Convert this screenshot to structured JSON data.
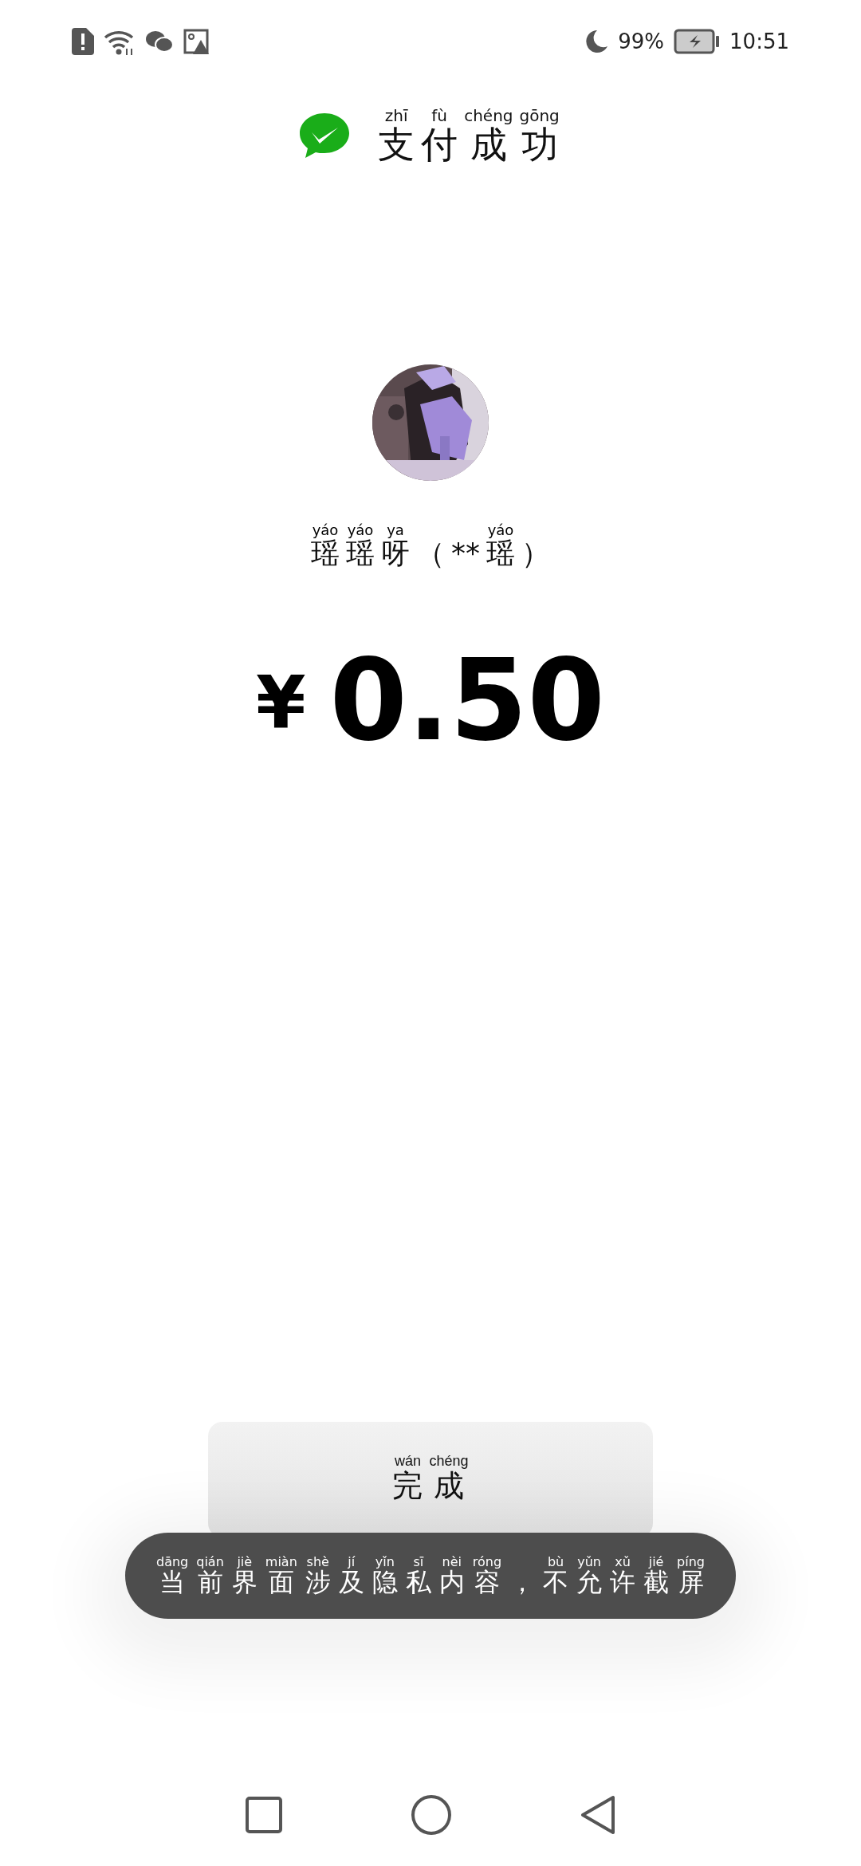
{
  "status_bar": {
    "battery_percent": "99%",
    "time": "10:51"
  },
  "header": {
    "title": [
      {
        "han": "支",
        "pinyin": "zhī"
      },
      {
        "han": "付",
        "pinyin": "fù"
      },
      {
        "han": "成",
        "pinyin": "chéng"
      },
      {
        "han": "功",
        "pinyin": "gōng"
      }
    ]
  },
  "payee": {
    "name": [
      {
        "han": "瑶",
        "pinyin": "yáo"
      },
      {
        "han": "瑶",
        "pinyin": "yáo"
      },
      {
        "han": "呀",
        "pinyin": "ya"
      },
      {
        "han": "（"
      },
      {
        "han": "**"
      },
      {
        "han": "瑶",
        "pinyin": "yáo"
      },
      {
        "han": "）"
      }
    ]
  },
  "amount": {
    "currency": "¥",
    "value": "0.50"
  },
  "done_button": {
    "label": [
      {
        "han": "完",
        "pinyin": "wán"
      },
      {
        "han": "成",
        "pinyin": "chéng"
      }
    ]
  },
  "toast": {
    "message": [
      {
        "han": "当",
        "pinyin": "dāng"
      },
      {
        "han": "前",
        "pinyin": "qián"
      },
      {
        "han": "界",
        "pinyin": "jiè"
      },
      {
        "han": "面",
        "pinyin": "miàn"
      },
      {
        "han": "涉",
        "pinyin": "shè"
      },
      {
        "han": "及",
        "pinyin": "jí"
      },
      {
        "han": "隐",
        "pinyin": "yǐn"
      },
      {
        "han": "私",
        "pinyin": "sī"
      },
      {
        "han": "内",
        "pinyin": "nèi"
      },
      {
        "han": "容",
        "pinyin": "róng"
      },
      {
        "han": "，"
      },
      {
        "han": "不",
        "pinyin": "bù"
      },
      {
        "han": "允",
        "pinyin": "yǔn"
      },
      {
        "han": "许",
        "pinyin": "xǔ"
      },
      {
        "han": "截",
        "pinyin": "jié"
      },
      {
        "han": "屏",
        "pinyin": "píng"
      }
    ]
  }
}
